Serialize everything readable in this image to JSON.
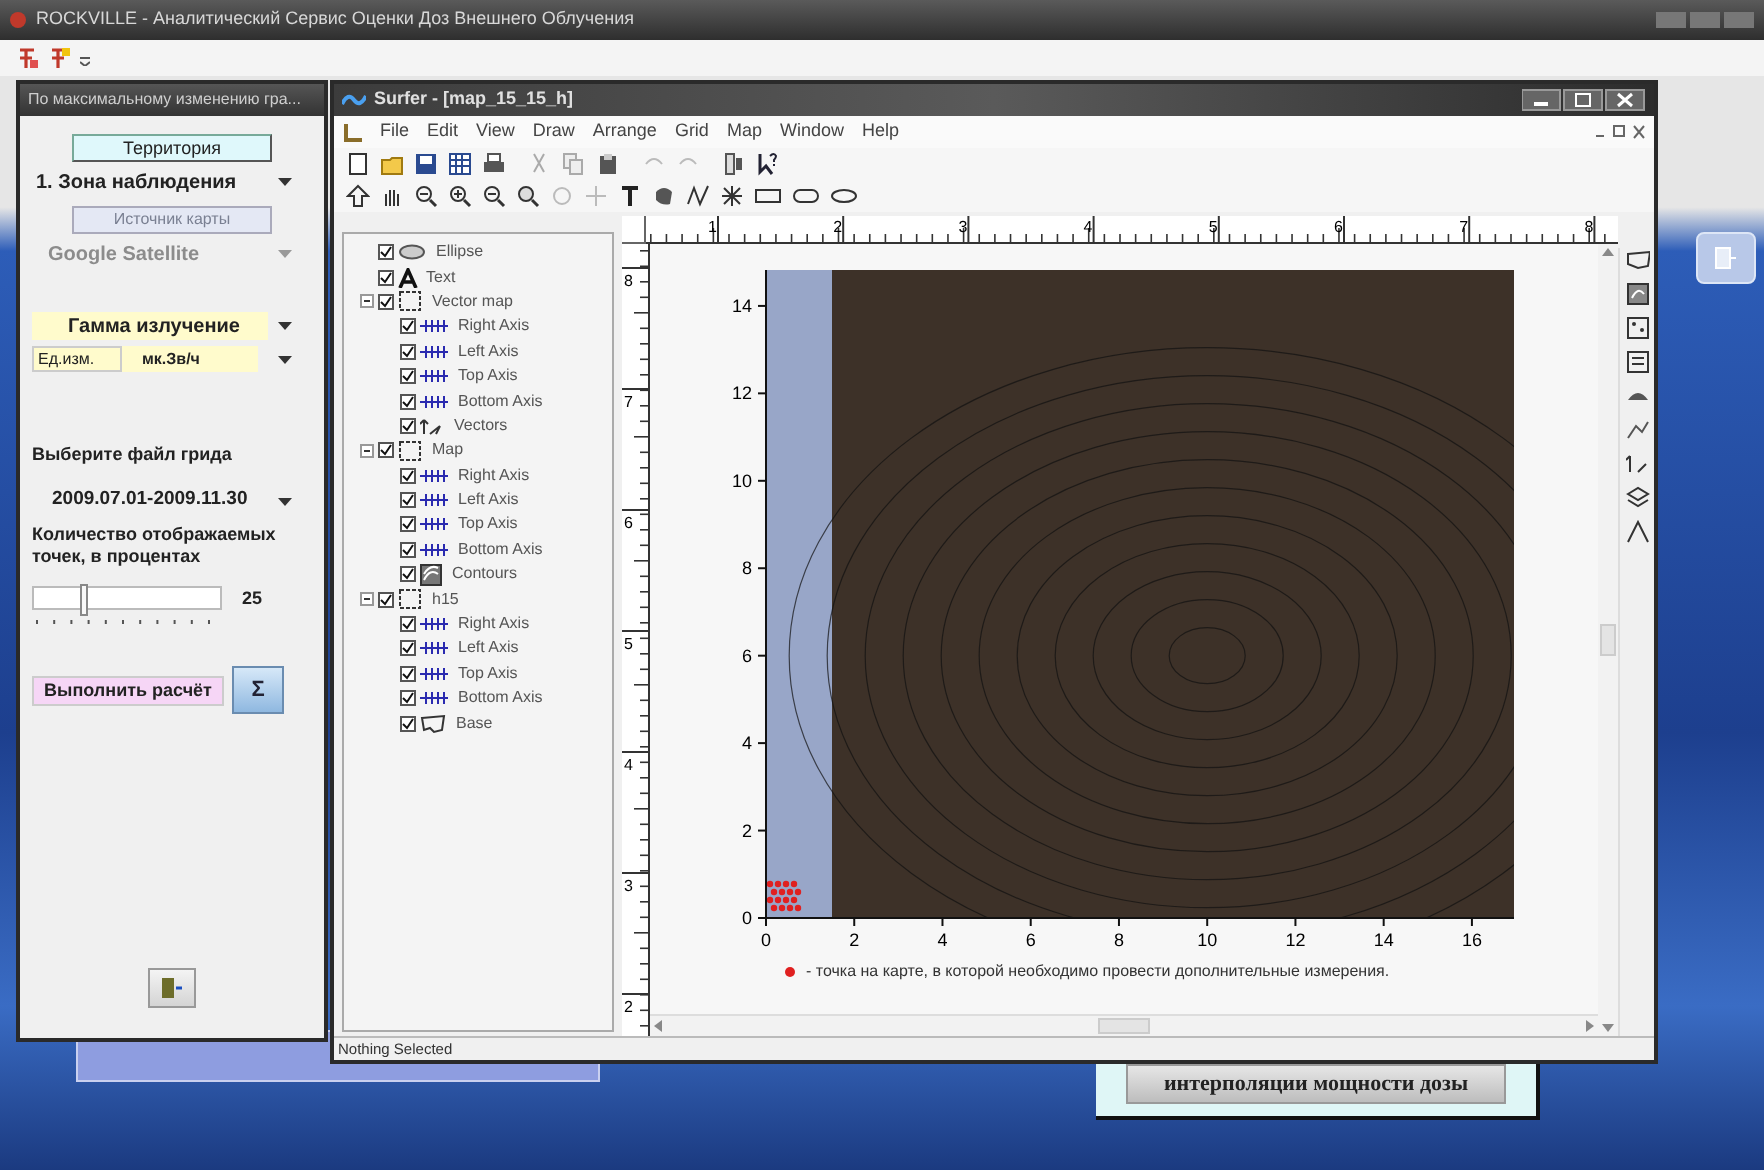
{
  "app_window": {
    "title": "ROCKVILLE - Аналитический Сервис Оценки Доз Внешнего Облучения"
  },
  "left_panel": {
    "title": "По максимальному изменению гра...",
    "territory_button": "Территория",
    "zone_dropdown": "1. Зона наблюдения",
    "map_source_button": {
      "label": "Источник карты",
      "disabled": true
    },
    "map_dropdown": {
      "value": "Google Satellite",
      "disabled": true
    },
    "radiation_dropdown": "Гамма излучение",
    "unit_label": "Ед.изм.",
    "unit_dropdown": "мк.Зв/ч",
    "grid_label": "Выберите файл грида",
    "grid_dropdown": "2009.07.01-2009.11.30",
    "points_label": "Количество отображаемых точек, в процентах",
    "points_slider": {
      "level": 0.25,
      "reading": "25"
    },
    "run_button": "Выполнить расчёт",
    "sigma_button": "Σ"
  },
  "surfer": {
    "title": "Surfer - [map_15_15_h]",
    "menu": [
      "File",
      "Edit",
      "View",
      "Draw",
      "Arrange",
      "Grid",
      "Map",
      "Window",
      "Help"
    ],
    "tree": [
      {
        "label": "Ellipse",
        "kind": "ellipse",
        "checked": true
      },
      {
        "label": "Text",
        "kind": "text",
        "checked": true
      },
      {
        "label": "Vector map",
        "kind": "group",
        "checked": true,
        "expanded": true,
        "children": [
          {
            "label": "Right Axis",
            "kind": "axis",
            "checked": true
          },
          {
            "label": "Left Axis",
            "kind": "axis",
            "checked": true
          },
          {
            "label": "Top Axis",
            "kind": "axis",
            "checked": true
          },
          {
            "label": "Bottom Axis",
            "kind": "axis",
            "checked": true
          },
          {
            "label": "Vectors",
            "kind": "vectors",
            "checked": true
          }
        ]
      },
      {
        "label": "Map",
        "kind": "group",
        "checked": true,
        "expanded": true,
        "children": [
          {
            "label": "Right Axis",
            "kind": "axis",
            "checked": true
          },
          {
            "label": "Left Axis",
            "kind": "axis",
            "checked": true
          },
          {
            "label": "Top Axis",
            "kind": "axis",
            "checked": true
          },
          {
            "label": "Bottom Axis",
            "kind": "axis",
            "checked": true
          },
          {
            "label": "Contours",
            "kind": "contours",
            "checked": true
          }
        ]
      },
      {
        "label": "h15",
        "kind": "group",
        "checked": true,
        "expanded": true,
        "children": [
          {
            "label": "Right Axis",
            "kind": "axis",
            "checked": true
          },
          {
            "label": "Left Axis",
            "kind": "axis",
            "checked": true
          },
          {
            "label": "Top Axis",
            "kind": "axis",
            "checked": true
          },
          {
            "label": "Bottom Axis",
            "kind": "axis",
            "checked": true
          },
          {
            "label": "Base",
            "kind": "base",
            "checked": true
          }
        ]
      }
    ],
    "ruler_h": [
      "1",
      "2",
      "3",
      "4",
      "5",
      "6",
      "7",
      "8"
    ],
    "ruler_v": [
      "8",
      "7",
      "6",
      "5",
      "4",
      "3",
      "2"
    ],
    "map": {
      "y_ticks": [
        "14",
        "12",
        "10",
        "8",
        "6",
        "4",
        "2",
        "0"
      ],
      "x_ticks": [
        "0",
        "2",
        "4",
        "6",
        "8",
        "10",
        "12",
        "14",
        "16"
      ],
      "legend": "- точка на карте, в которой необходимо провести дополнительные измерения."
    },
    "status": "Nothing Selected"
  },
  "background_button": "интерполяции мощности дозы"
}
